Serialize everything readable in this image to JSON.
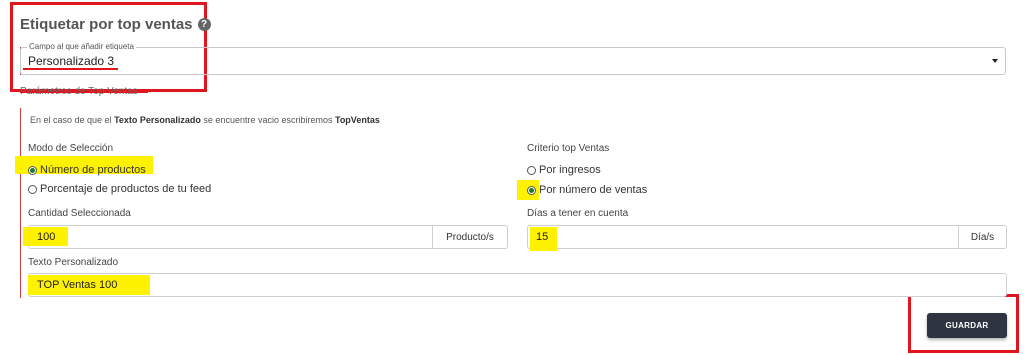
{
  "header": {
    "title": "Etiquetar por top ventas",
    "help_icon": "?"
  },
  "field": {
    "legend": "Campo al que añadir etiqueta",
    "value": "Personalizado 3"
  },
  "params": {
    "section_label": "Parámetros de Top Ventas",
    "info_pre": "En el caso de que el ",
    "info_bold1": "Texto Personalizado",
    "info_mid": " se encuentre vacio escribiremos ",
    "info_bold2": "TopVentas"
  },
  "modo": {
    "label": "Modo de Selección",
    "options": [
      {
        "label": "Número de productos",
        "selected": true
      },
      {
        "label": "Porcentaje de productos de tu feed",
        "selected": false
      }
    ]
  },
  "criterio": {
    "label": "Criterio top Ventas",
    "options": [
      {
        "label": "Por ingresos",
        "selected": false
      },
      {
        "label": "Por número de ventas",
        "selected": true
      }
    ]
  },
  "cantidad": {
    "label": "Cantidad Seleccionada",
    "value": "100",
    "unit": "Producto/s"
  },
  "dias": {
    "label": "Días a tener en cuenta",
    "value": "15",
    "unit": "Día/s"
  },
  "texto": {
    "label": "Texto Personalizado",
    "value": "TOP Ventas 100"
  },
  "actions": {
    "save_label": "GUARDAR"
  },
  "colors": {
    "highlight": "#fff200",
    "annotation_red": "#e0161e",
    "button": "#2f3540",
    "radio_selected": "#1b7a2c"
  }
}
